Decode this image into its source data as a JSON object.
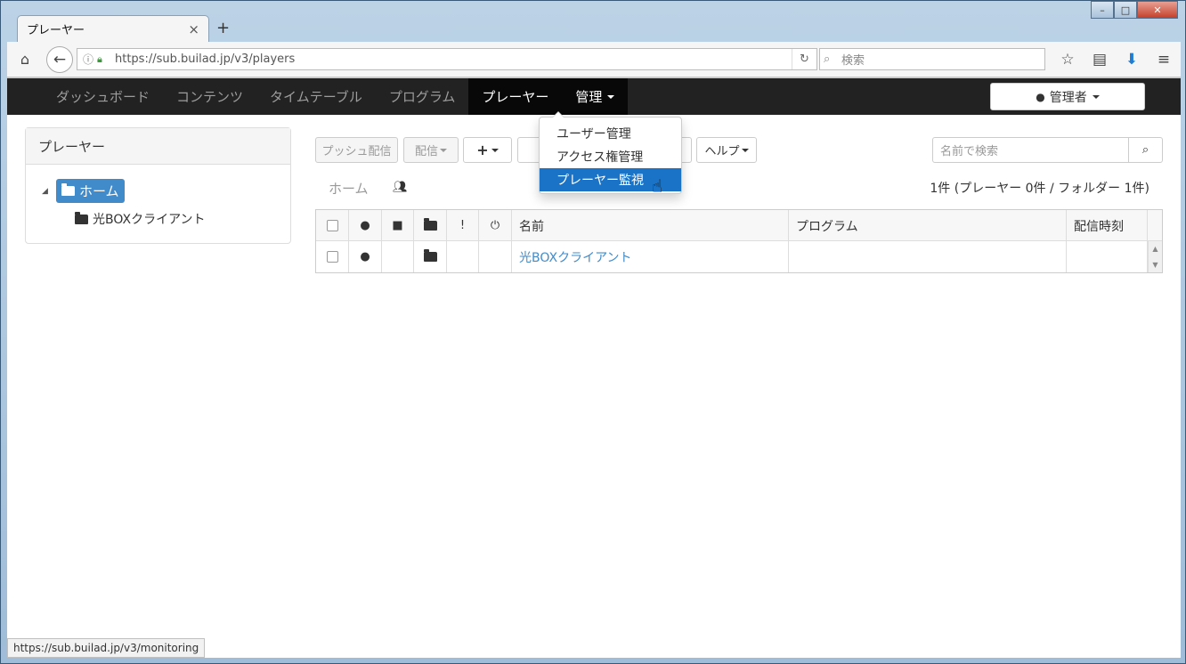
{
  "browser": {
    "tab_title": "プレーヤー",
    "tab_close": "×",
    "new_tab": "+",
    "url": "https://sub.builad.jp/v3/players",
    "search_placeholder": "検索",
    "window_buttons": {
      "minimize": "–",
      "maximize": "□",
      "close": "✕"
    }
  },
  "navbar": {
    "items": [
      {
        "label": "ダッシュボード",
        "state": "normal"
      },
      {
        "label": "コンテンツ",
        "state": "normal"
      },
      {
        "label": "タイムテーブル",
        "state": "normal"
      },
      {
        "label": "プログラム",
        "state": "normal"
      },
      {
        "label": "プレーヤー",
        "state": "active"
      },
      {
        "label": "管理",
        "state": "open"
      }
    ],
    "user_label": "管理者"
  },
  "admin_menu": {
    "items": [
      "ユーザー管理",
      "アクセス権管理",
      "プレーヤー監視"
    ],
    "highlighted": "プレーヤー監視"
  },
  "sidebar": {
    "title": "プレーヤー",
    "tree": {
      "root_label": "ホーム",
      "children": [
        "光BOXクライアント"
      ]
    }
  },
  "toolbar": {
    "push_label": "プッシュ配信",
    "deliver_label": "配信",
    "add_label": "+",
    "help_label": "ヘルプ",
    "search_placeholder": "名前で検索"
  },
  "breadcrumb": {
    "home": "ホーム"
  },
  "summary": "1件 (プレーヤー 0件 / フォルダー 1件)",
  "table": {
    "columns": [
      "名前",
      "プログラム",
      "配信時刻"
    ],
    "rows": [
      {
        "name": "光BOXクライアント",
        "program": "",
        "time": ""
      }
    ]
  },
  "statusbar": "https://sub.builad.jp/v3/monitoring",
  "colors": {
    "navbar_bg": "#222222",
    "accent": "#428bca",
    "menu_highlight": "#1a73c6"
  },
  "icons": {
    "home": "home-icon",
    "back": "back-arrow-icon",
    "reload": "reload-icon",
    "bookmark": "star-icon",
    "library": "library-icon",
    "download": "download-icon",
    "menu": "hamburger-icon",
    "user": "user-icon",
    "lock": "lock-icon",
    "folder": "folder-open-icon",
    "alert": "exclamation-icon",
    "power": "power-icon",
    "search": "search-icon"
  }
}
